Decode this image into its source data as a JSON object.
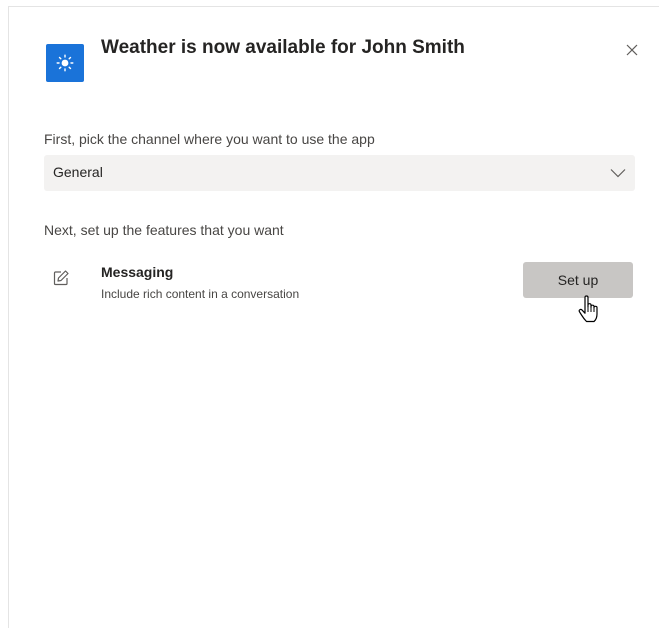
{
  "dialog": {
    "title": "Weather is now available for John Smith",
    "app_icon": "sun-icon",
    "accent_color": "#1a73d9",
    "close_icon": "close-icon"
  },
  "channel": {
    "label": "First, pick the channel where you want to use the app",
    "selected": "General",
    "chevron_icon": "chevron-down-icon"
  },
  "features": {
    "label": "Next, set up the features that you want",
    "items": [
      {
        "icon": "edit-icon",
        "title": "Messaging",
        "description": "Include rich content in a conversation",
        "button_label": "Set up"
      }
    ]
  },
  "pointer": "hand-cursor-icon"
}
